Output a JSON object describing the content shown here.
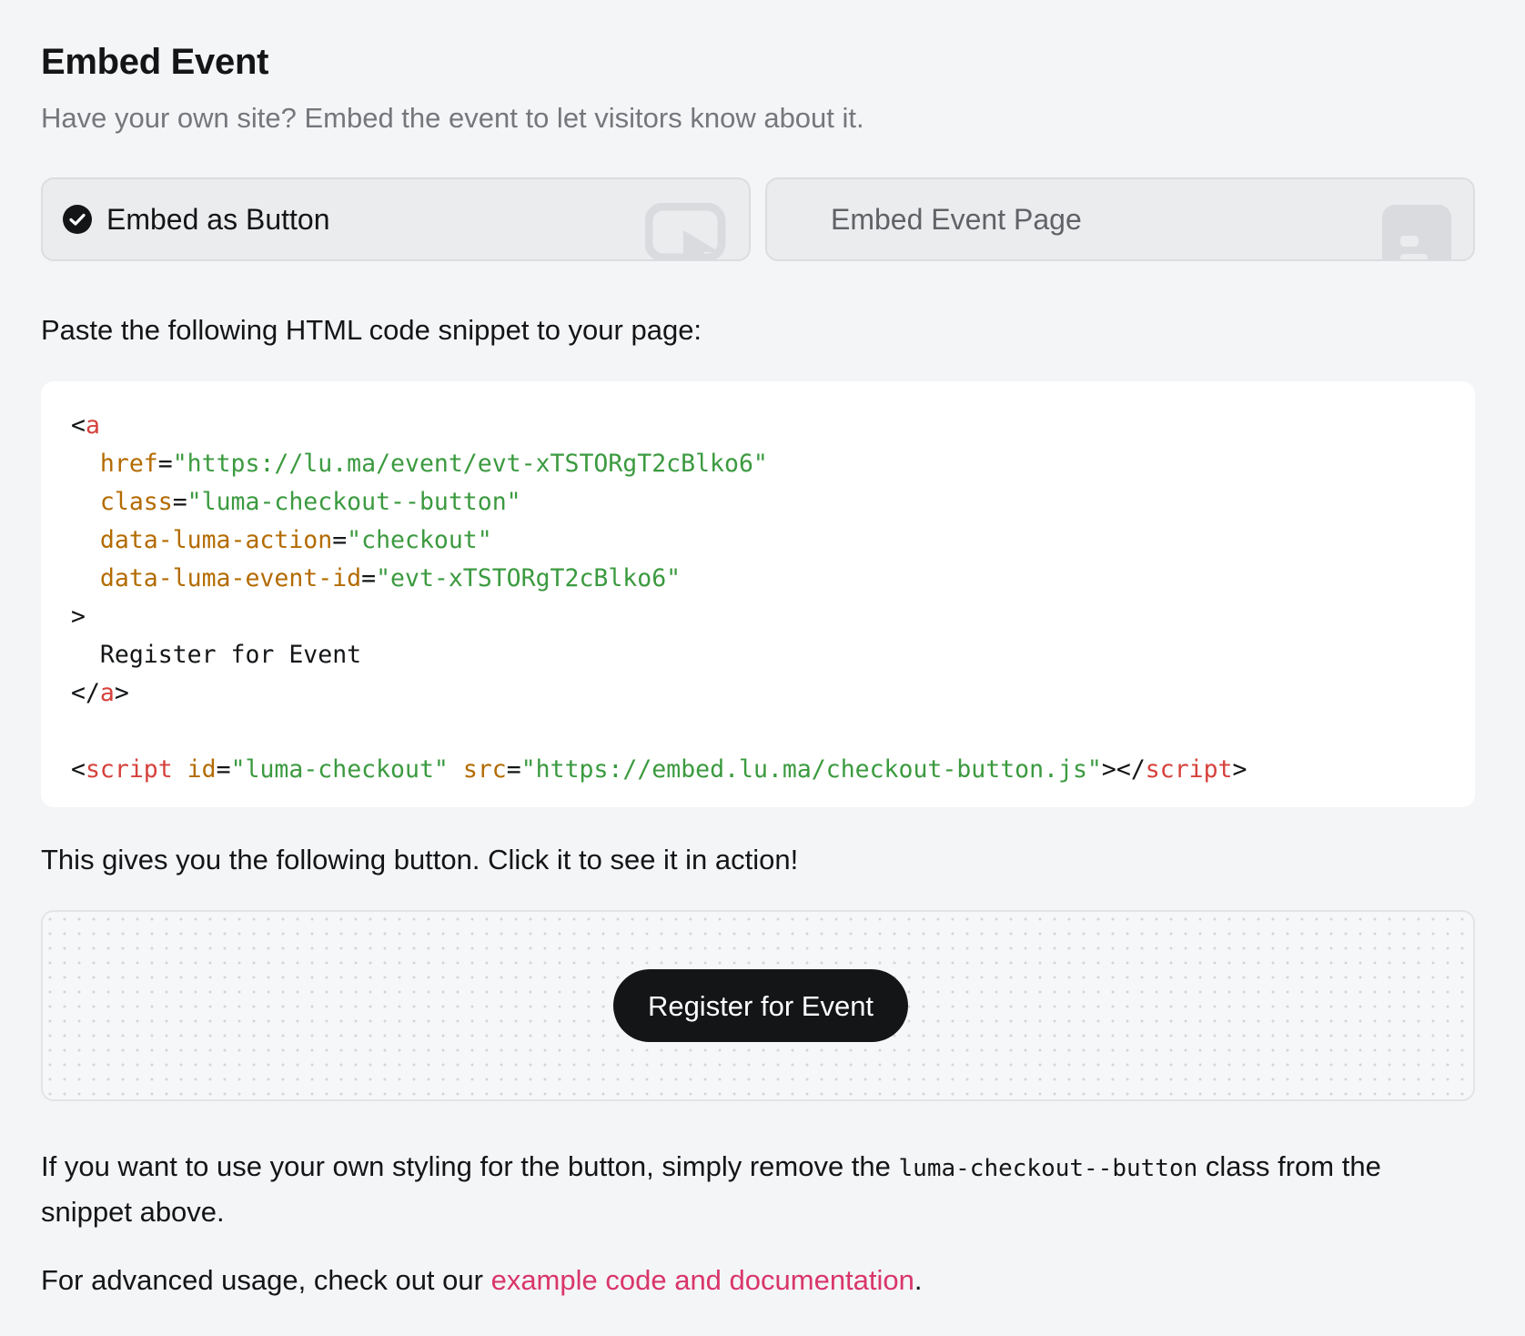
{
  "header": {
    "title": "Embed Event",
    "subtitle": "Have your own site? Embed the event to let visitors know about it."
  },
  "options": {
    "button": {
      "label": "Embed as Button",
      "selected": true,
      "icon": "check-circle-icon"
    },
    "page": {
      "label": "Embed Event Page",
      "selected": false
    }
  },
  "instructions": "Paste the following HTML code snippet to your page:",
  "snippet": {
    "tag_a": "a",
    "lt": "<",
    "gt": ">",
    "close_lt": "</",
    "eq": "=",
    "href_attr": "href",
    "href_val": "\"https://lu.ma/event/evt-xTSTORgT2cBlko6\"",
    "class_attr": "class",
    "class_val": "\"luma-checkout--button\"",
    "action_attr": "data-luma-action",
    "action_val": "\"checkout\"",
    "eventid_attr": "data-luma-event-id",
    "eventid_val": "\"evt-xTSTORgT2cBlko6\"",
    "link_text": "Register for Event",
    "tag_script": "script",
    "id_attr": "id",
    "id_val": "\"luma-checkout\"",
    "src_attr": "src",
    "src_val": "\"https://embed.lu.ma/checkout-button.js\""
  },
  "result_text": "This gives you the following button. Click it to see it in action!",
  "preview": {
    "button_label": "Register for Event"
  },
  "note": {
    "before": "If you want to use your own styling for the button, simply remove the ",
    "code": "luma-checkout--button",
    "after": " class from the snippet above."
  },
  "advanced": {
    "before": "For advanced usage, check out our ",
    "link": "example code and documentation",
    "after": "."
  },
  "colors": {
    "accent_link": "#d9366a",
    "code_tag": "#d6413c",
    "code_attr": "#b36b00",
    "code_string": "#3b9a3f"
  }
}
